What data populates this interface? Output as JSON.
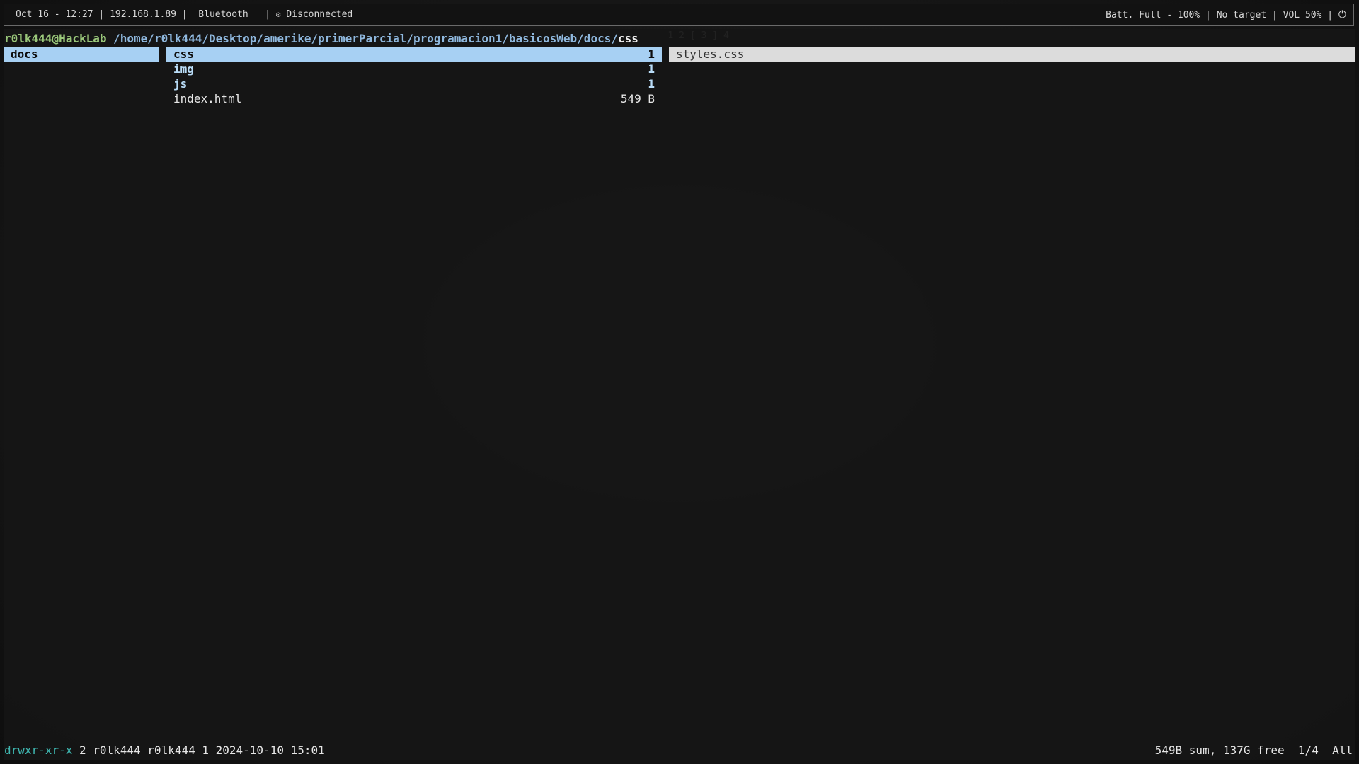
{
  "topbar": {
    "datetime": "Oct 16 - 12:27",
    "ip": "192.168.1.89",
    "bluetooth": "Bluetooth",
    "network": "Disconnected",
    "workspaces": [
      "1",
      "2",
      "3",
      "4"
    ],
    "active_workspace": "3",
    "battery": "Batt. Full - 100%",
    "target": "No target",
    "volume": "VOL 50%",
    "icons": {
      "network": "gear-icon",
      "power": "power-icon"
    }
  },
  "terminal": {
    "prompt_user": "r0lk444@HackLab",
    "prompt_path": "/home/r0lk444/Desktop/amerike/primerParcial/programacion1/basicosWeb/docs/",
    "prompt_leaf": "css",
    "parent_column": [
      {
        "name": "docs",
        "selected": true
      }
    ],
    "current_column": [
      {
        "name": "css",
        "size": "1",
        "type": "dir",
        "selected": true
      },
      {
        "name": "img",
        "size": "1",
        "type": "dir",
        "selected": false
      },
      {
        "name": "js",
        "size": "1",
        "type": "dir",
        "selected": false
      },
      {
        "name": "index.html",
        "size": "549 B",
        "type": "file",
        "selected": false
      }
    ],
    "preview_column": [
      {
        "name": "styles.css",
        "selected": true
      }
    ],
    "status": {
      "permissions": "drwxr-xr-x",
      "details": "2 r0lk444 r0lk444 1 2024-10-10 15:01",
      "summary": "549B sum, 137G free",
      "position": "1/4",
      "scroll": "All"
    }
  },
  "colors": {
    "selection": "#a7d0f3",
    "directory": "#b9dcf7",
    "user": "#9ac77a",
    "path": "#8fb8de",
    "permissions": "#3fb7b1"
  }
}
